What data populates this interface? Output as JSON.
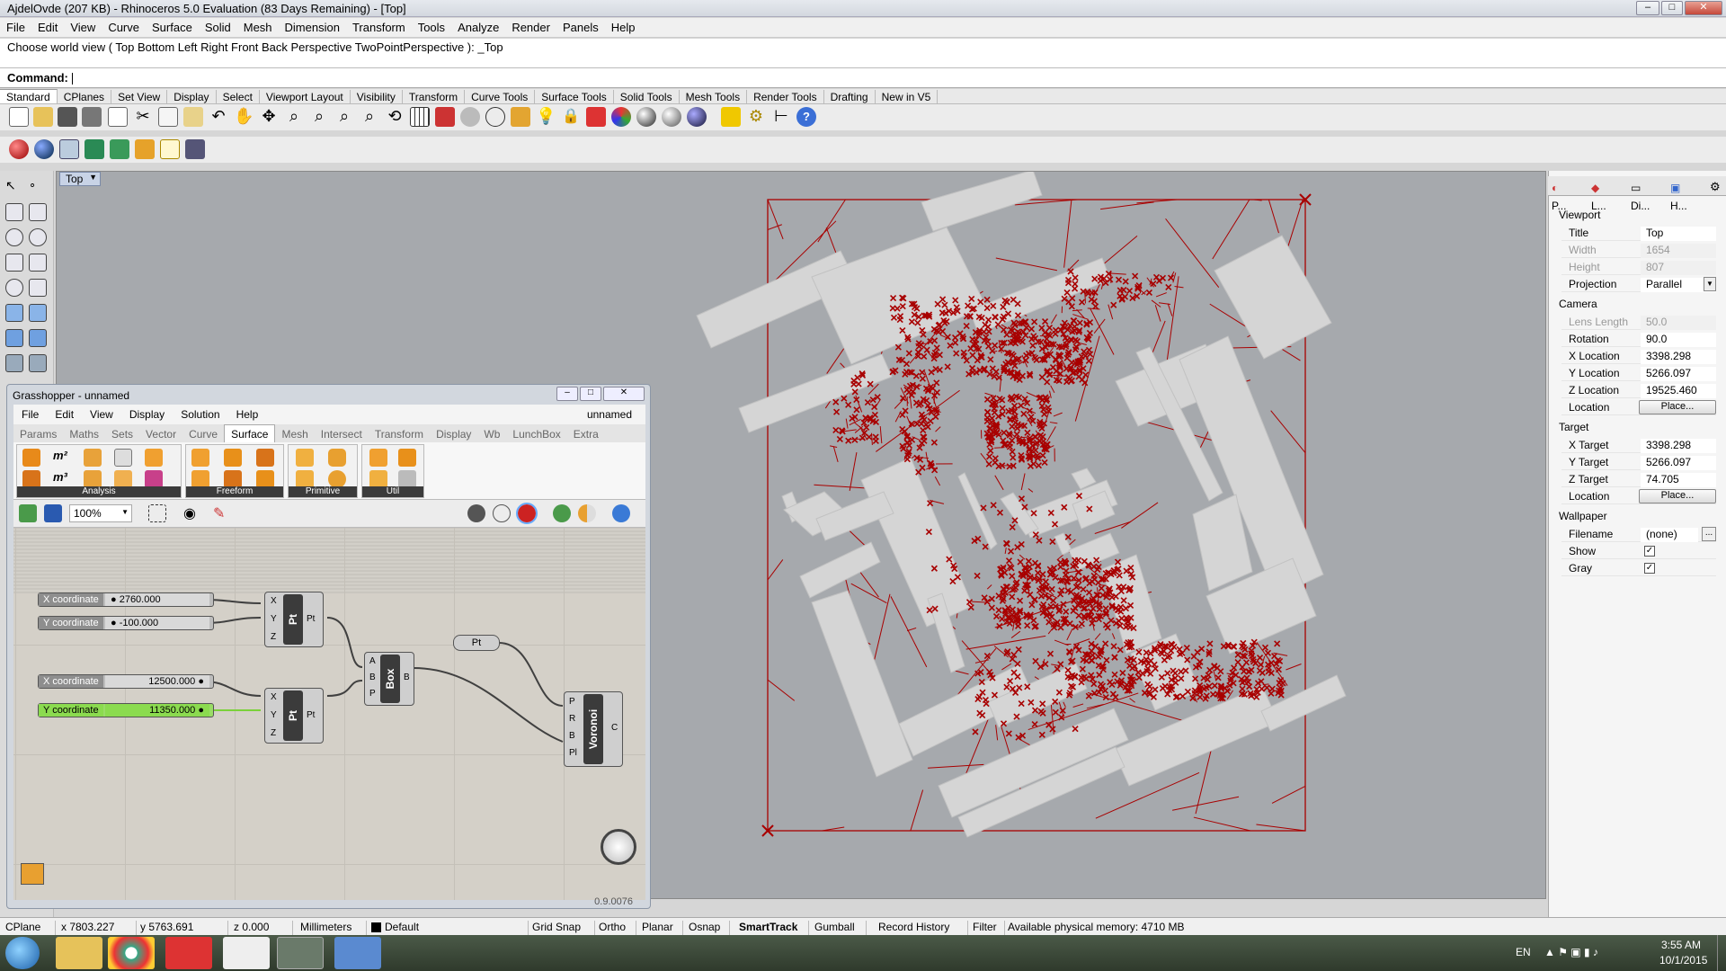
{
  "window": {
    "title": "AjdelOvde (207 KB) - Rhinoceros 5.0 Evaluation (83 Days Remaining) - [Top]"
  },
  "menu": [
    "File",
    "Edit",
    "View",
    "Curve",
    "Surface",
    "Solid",
    "Mesh",
    "Dimension",
    "Transform",
    "Tools",
    "Analyze",
    "Render",
    "Panels",
    "Help"
  ],
  "command": {
    "history": "Choose world view ( Top  Bottom  Left  Right  Front  Back  Perspective  TwoPointPerspective ): _Top",
    "label": "Command:",
    "value": ""
  },
  "toolbar_tabs": [
    "Standard",
    "CPlanes",
    "Set View",
    "Display",
    "Select",
    "Viewport Layout",
    "Visibility",
    "Transform",
    "Curve Tools",
    "Surface Tools",
    "Solid Tools",
    "Mesh Tools",
    "Render Tools",
    "Drafting",
    "New in V5"
  ],
  "viewport": {
    "label": "Top"
  },
  "panel_tabs": [
    "P...",
    "L...",
    "Di...",
    "H..."
  ],
  "properties": {
    "viewport_header": "Viewport",
    "title_label": "Title",
    "title_value": "Top",
    "width_label": "Width",
    "width_value": "1654",
    "height_label": "Height",
    "height_value": "807",
    "projection_label": "Projection",
    "projection_value": "Parallel",
    "camera_header": "Camera",
    "lens_label": "Lens Length",
    "lens_value": "50.0",
    "rotation_label": "Rotation",
    "rotation_value": "90.0",
    "xloc_label": "X Location",
    "xloc_value": "3398.298",
    "yloc_label": "Y Location",
    "yloc_value": "5266.097",
    "zloc_label": "Z Location",
    "zloc_value": "19525.460",
    "location_label": "Location",
    "place_label": "Place...",
    "target_header": "Target",
    "xt_label": "X Target",
    "xt_value": "3398.298",
    "yt_label": "Y Target",
    "yt_value": "5266.097",
    "zt_label": "Z Target",
    "zt_value": "74.705",
    "tloc_label": "Location",
    "tplace_label": "Place...",
    "wallpaper_header": "Wallpaper",
    "filename_label": "Filename",
    "filename_value": "(none)",
    "browse_label": "...",
    "show_label": "Show",
    "gray_label": "Gray",
    "check_mark": "✓"
  },
  "grasshopper": {
    "title": "Grasshopper - unnamed",
    "doc_name": "unnamed",
    "menu": [
      "File",
      "Edit",
      "View",
      "Display",
      "Solution",
      "Help"
    ],
    "tabs": [
      "Params",
      "Maths",
      "Sets",
      "Vector",
      "Curve",
      "Surface",
      "Mesh",
      "Intersect",
      "Transform",
      "Display",
      "Wb",
      "LunchBox",
      "Extra"
    ],
    "ribbon_groups": [
      "Analysis",
      "Freeform",
      "Primitive",
      "Util"
    ],
    "zoom": "100%",
    "version": "0.9.0076",
    "sliders": [
      {
        "label": "X coordinate",
        "value": "2760.000"
      },
      {
        "label": "Y coordinate",
        "value": "-100.000"
      },
      {
        "label": "X coordinate",
        "value": "12500.000"
      },
      {
        "label": "Y coordinate",
        "value": "11350.000"
      }
    ],
    "components": {
      "pt": "Pt",
      "box": "Box",
      "voronoi": "Voronoi",
      "pt_param": "Pt",
      "pins_xyz": [
        "X",
        "Y",
        "Z"
      ],
      "pins_abp": [
        "A",
        "B",
        "P"
      ],
      "pins_voronoi": [
        "P",
        "R",
        "B",
        "Pl"
      ],
      "out_pt": "Pt",
      "out_b": "B",
      "out_c": "C"
    }
  },
  "status": {
    "cplane": "CPlane",
    "x": "x 7803.227",
    "y": "y 5763.691",
    "z": "z 0.000",
    "units": "Millimeters",
    "layer": "Default",
    "items": [
      "Grid Snap",
      "Ortho",
      "Planar",
      "Osnap",
      "SmartTrack",
      "Gumball",
      "Record History",
      "Filter"
    ],
    "memory": "Available physical memory: 4710 MB"
  },
  "taskbar": {
    "lang": "EN",
    "time": "3:55 AM",
    "date": "10/1/2015"
  },
  "colors": {
    "accent": "#a80000",
    "viewport_bg": "#a6a9ad",
    "building": "#d5d5d5"
  }
}
